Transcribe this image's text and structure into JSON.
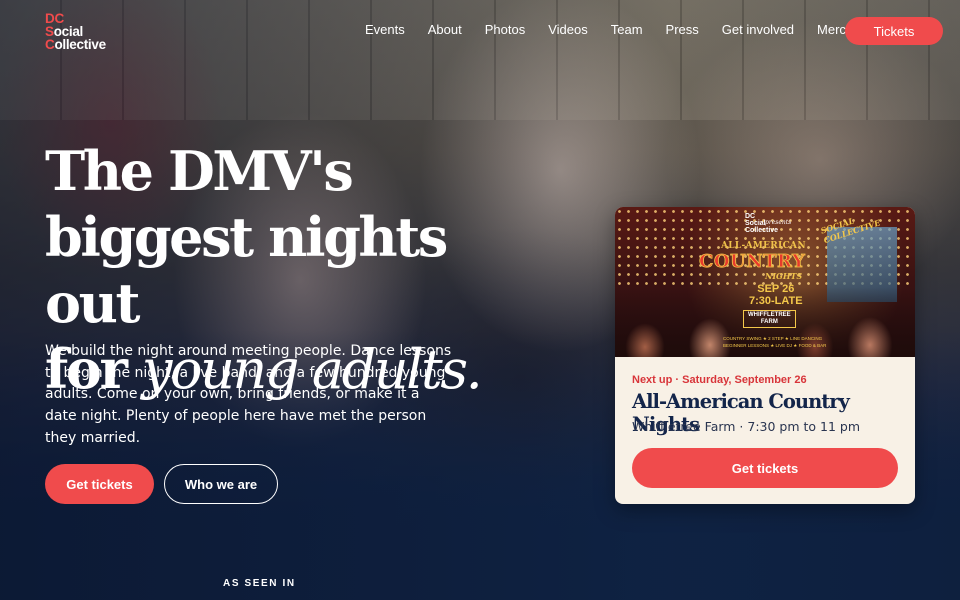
{
  "brand": {
    "logo_line1": "DC",
    "logo_line2": "Social",
    "logo_line3": "Collective",
    "accent": "#f04b4c",
    "navy": "#0d1f3d"
  },
  "nav": {
    "items": [
      "Events",
      "About",
      "Photos",
      "Videos",
      "Team",
      "Press",
      "Get involved",
      "Merch"
    ],
    "tickets_label": "Tickets"
  },
  "hero": {
    "headline_line1": "The DMV's",
    "headline_line2": "biggest nights out",
    "headline_line3_plain": "for ",
    "headline_line3_italic": "young adults.",
    "intro": "We build the night around meeting people. Dance lessons to begin the night, a live band, and a few hundred young adults. Come on your own, bring friends, or make it a date night. Plenty of people here have met the person they married.",
    "primary_button": "Get tickets",
    "secondary_button": "Who we are"
  },
  "event_card": {
    "poster": {
      "mini_logo_1": "DC",
      "mini_logo_2": "Social",
      "mini_logo_3": "Collective",
      "presents": "presents",
      "title_top": "ALL-AMERICAN",
      "title_main": "COUNTRY",
      "title_bottom": "NIGHTS",
      "date": "SEP 26",
      "time": "7:30-LATE",
      "venue_line1": "WHIFFLETREE",
      "venue_line2": "FARM",
      "extras_line1": "COUNTRY SWING ★ 2 STEP ★ LINE DANCING",
      "extras_line2": "BEGINNER LESSONS ★ LIVE DJ ★ FOOD & BAR",
      "banner": "SOCIAL COLLECTIVE"
    },
    "next_up": "Next up · Saturday, September 26",
    "title": "All-American Country Nights",
    "meta": "Whiffletree Farm · 7:30 pm to 11 pm",
    "button": "Get tickets"
  },
  "seen_in": "AS SEEN IN"
}
